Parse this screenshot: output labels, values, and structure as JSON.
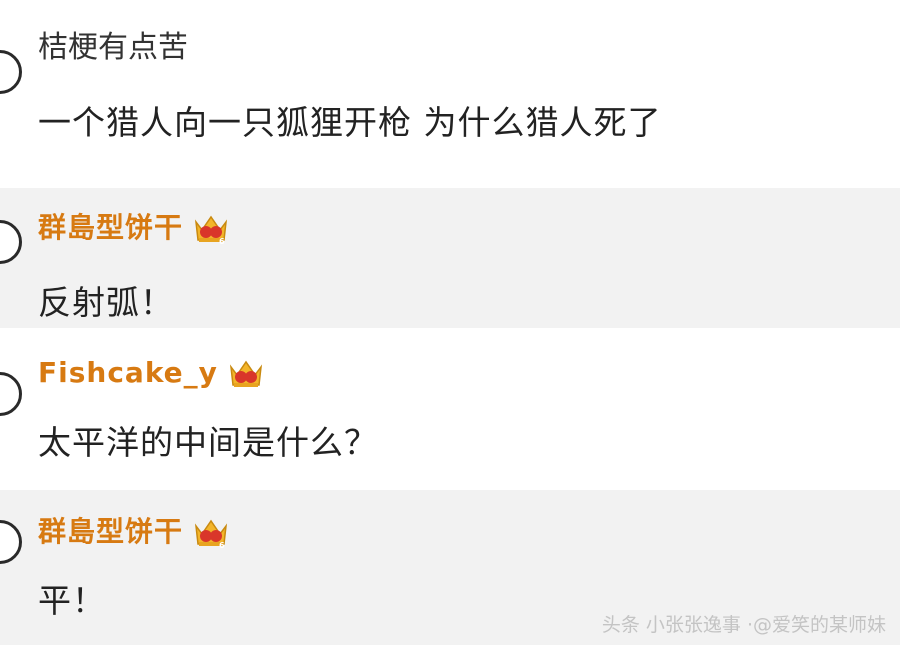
{
  "comments": [
    {
      "name": "桔梗有点苦",
      "message": "一个猎人向一只狐狸开枪  为什么猎人死了"
    },
    {
      "name": "群島型饼干",
      "message": "反射弧！"
    },
    {
      "name": "Fishcake_y",
      "message": "太平洋的中间是什么？"
    },
    {
      "name": "群島型饼干",
      "message": "平！"
    }
  ],
  "watermark": {
    "text": "头条 小张张逸事 ·@爱笑的某师妹"
  },
  "colors": {
    "vip_name": "#d77a12",
    "alt_row_bg": "#f2f2f2",
    "crown_red": "#d9362a",
    "crown_gold": "#f3b52a"
  },
  "icons": {
    "badge": "crown-icon",
    "avatar": "avatar"
  }
}
